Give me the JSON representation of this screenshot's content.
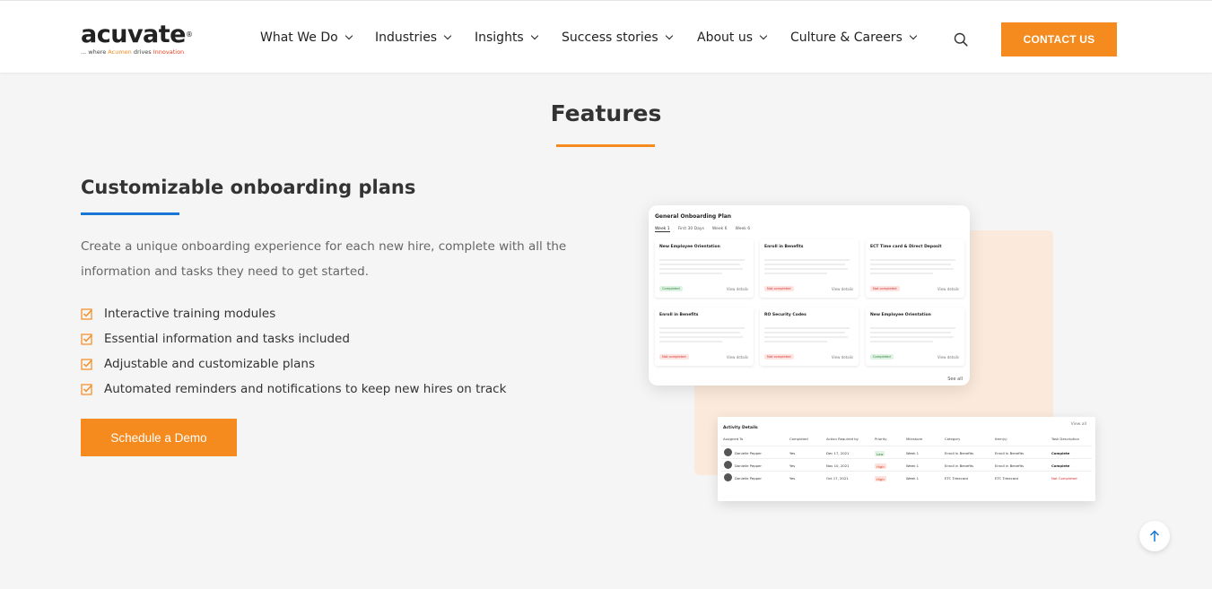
{
  "header": {
    "logo_text": "acuvate",
    "logo_reg": "®",
    "tagline_pre": "... where ",
    "tagline_acumen": "Acumen",
    "tagline_mid": " drives ",
    "tagline_innov": "Innovation",
    "nav": [
      "What We Do",
      "Industries",
      "Insights",
      "Success stories",
      "About us",
      "Culture & Careers"
    ],
    "contact_label": "CONTACT US"
  },
  "features": {
    "title": "Features"
  },
  "section": {
    "title": "Customizable onboarding plans",
    "description": "Create a unique onboarding experience for each new hire, complete with all the information and tasks they need to get started.",
    "items": [
      "Interactive training modules",
      "Essential information and tasks included",
      "Adjustable and customizable plans",
      "Automated reminders and notifications to keep new hires on track"
    ],
    "demo_label": "Schedule a Demo"
  },
  "plan": {
    "title": "General Onboarding Plan",
    "tabs": [
      "Week 1",
      "First 30 Days",
      "Week 6",
      "Week 6"
    ],
    "cards": [
      {
        "title": "New Employee Orientation",
        "status": "Completed",
        "done": true
      },
      {
        "title": "Enroll in Benefits",
        "status": "Not completed",
        "done": false
      },
      {
        "title": "ECT Time card & Direct Deposit",
        "status": "Not completed",
        "done": false
      },
      {
        "title": "Enroll in Benefits",
        "status": "Not completed",
        "done": false
      },
      {
        "title": "RO Security Codes",
        "status": "Not completed",
        "done": false
      },
      {
        "title": "New Employee Orientation",
        "status": "Completed",
        "done": true
      }
    ],
    "view_details": "View details",
    "see_all": "See all"
  },
  "activity": {
    "title": "Activity Details",
    "view_all": "View all",
    "headers": [
      "Assigned To",
      "Completed",
      "Action Required by",
      "Priority",
      "Milestone",
      "Category",
      "Item(s)",
      "Task Description"
    ],
    "rows": [
      {
        "name": "Danielle Pepper",
        "completed": "Yes",
        "date": "Dec 17, 2021",
        "priority": "Low",
        "milestone": "Week 1",
        "category": "Enroll in Benefits",
        "item": "Enroll in Benefits",
        "status": "Complete"
      },
      {
        "name": "Danielle Pepper",
        "completed": "Yes",
        "date": "Nov 10, 2021",
        "priority": "High",
        "milestone": "Week 1",
        "category": "Enroll in Benefits",
        "item": "Enroll in Benefits",
        "status": "Complete"
      },
      {
        "name": "Danielle Pepper",
        "completed": "Yes",
        "date": "Oct 17, 2021",
        "priority": "High",
        "milestone": "Week 1",
        "category": "ETC Timecard",
        "item": "ETC Timecard",
        "status": "Not Completed"
      }
    ]
  },
  "colors": {
    "accent": "#f58a1f",
    "blue_line": "#1976d2"
  },
  "icons": {
    "search": "search-icon",
    "check": "checkbox-check-icon",
    "scroll": "arrow-up-icon"
  }
}
